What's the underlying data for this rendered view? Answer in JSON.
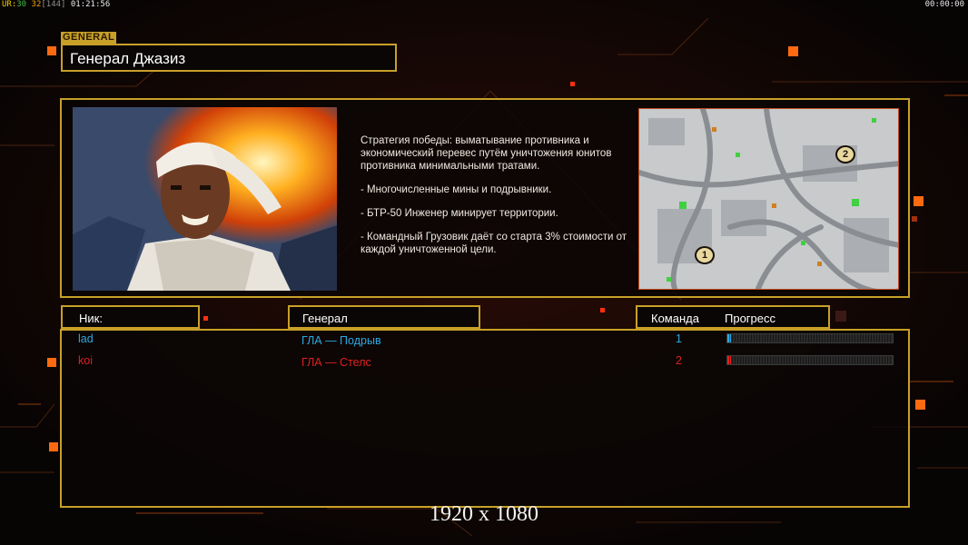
{
  "hud": {
    "left": [
      {
        "text": "UR:",
        "color": "#f0d000"
      },
      {
        "text": "30",
        "color": "#40c040"
      },
      {
        "text": " ",
        "color": "#ffffff"
      },
      {
        "text": "32",
        "color": "#f0a000"
      },
      {
        "text": "[144]",
        "color": "#909090"
      },
      {
        "text": " 01:21:56",
        "color": "#e8e8e8"
      }
    ],
    "right": "00:00:00"
  },
  "general_tag": "GENERAL",
  "general_name": "Генерал Джазиз",
  "description": [
    "Стратегия победы: выматывание противника и экономический перевес путём уничтожения юнитов противника минимальными тратами.",
    "- Многочисленные мины и подрывники.",
    "- БТР-50 Инженер минирует территории.",
    "- Командный Грузовик даёт со старта 3% стоимости от каждой уничтоженной цели."
  ],
  "map": {
    "markers": [
      {
        "label": "1",
        "icon": "start-position-marker"
      },
      {
        "label": "2",
        "icon": "start-position-marker"
      }
    ]
  },
  "columns": {
    "nick": "Ник:",
    "general": "Генерал",
    "team": "Команда",
    "progress": "Прогресс"
  },
  "players": [
    {
      "nick": "lad",
      "general": "ГЛА — Подрыв",
      "team": "1",
      "progress": 0.01,
      "color": "#2ea8e0"
    },
    {
      "nick": "koi",
      "general": "ГЛА — Стелс",
      "team": "2",
      "progress": 0.01,
      "color": "#e02020"
    }
  ],
  "resolution": "1920 x 1080",
  "colors": {
    "accent": "#c8a028",
    "orange": "#ff6a10"
  }
}
